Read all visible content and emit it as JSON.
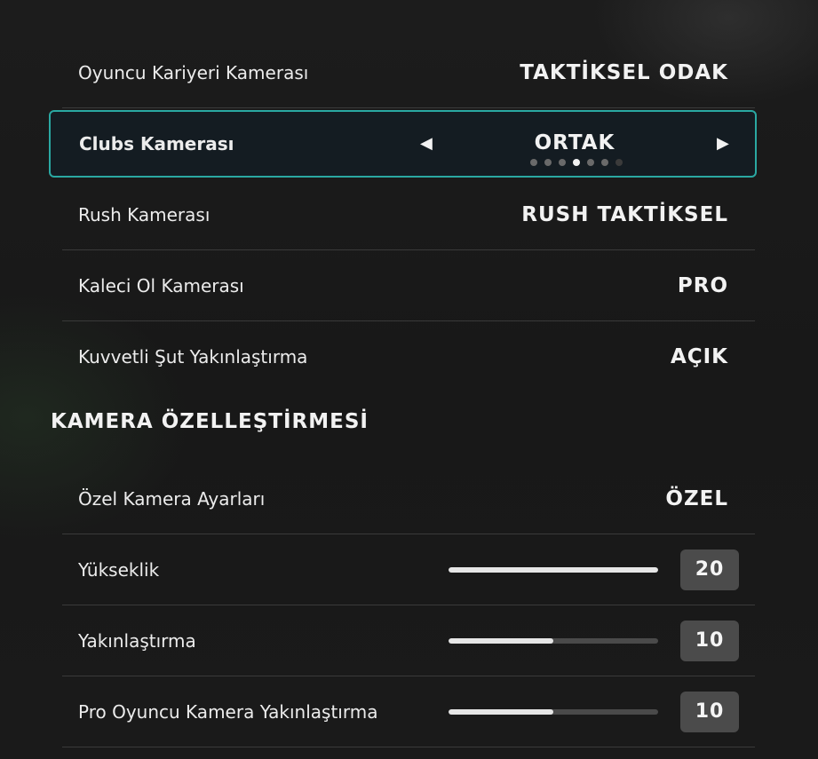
{
  "camera_rows": [
    {
      "label": "Oyuncu Kariyeri Kamerası",
      "value": "TAKTİKSEL ODAK"
    },
    {
      "label": "Clubs Kamerası",
      "value": "ORTAK",
      "option_count": 7,
      "selected_index": 3
    },
    {
      "label": "Rush Kamerası",
      "value": "RUSH TAKTİKSEL"
    },
    {
      "label": "Kaleci Ol Kamerası",
      "value": "PRO"
    },
    {
      "label": "Kuvvetli Şut Yakınlaştırma",
      "value": "AÇIK"
    }
  ],
  "section": {
    "title": "KAMERA ÖZELLEŞTİRMESİ"
  },
  "custom_rows": [
    {
      "label": "Özel Kamera Ayarları",
      "value": "ÖZEL"
    }
  ],
  "slider_rows": [
    {
      "label": "Yükseklik",
      "value": "20",
      "fill_fraction": 1.0
    },
    {
      "label": "Yakınlaştırma",
      "value": "10",
      "fill_fraction": 0.5
    },
    {
      "label": "Pro Oyuncu Kamera Yakınlaştırma",
      "value": "10",
      "fill_fraction": 0.5
    }
  ],
  "icons": {
    "prev": "◀",
    "next": "▶"
  },
  "colors": {
    "accent": "#2aa8a2",
    "selected_bg": "#141c22",
    "slider_fill": "#e6e6e6",
    "slider_track": "#4a4a4a",
    "value_box": "#4b4b4b"
  }
}
